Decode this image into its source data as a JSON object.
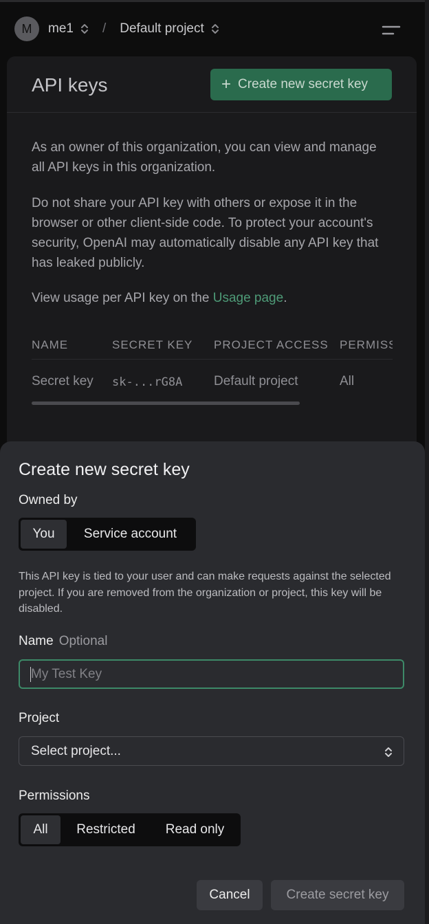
{
  "nav": {
    "avatar_initial": "M",
    "org_name": "me1",
    "separator": "/",
    "project_name": "Default project"
  },
  "page": {
    "title": "API keys",
    "create_button_label": "Create new secret key",
    "intro": "As an owner of this organization, you can view and manage all API keys in this organization.",
    "warning": "Do not share your API key with others or expose it in the browser or other client-side code. To protect your account's security, OpenAI may automatically disable any API key that has leaked publicly.",
    "usage_prefix": "View usage per API key on the ",
    "usage_link": "Usage page",
    "usage_suffix": "."
  },
  "table": {
    "columns": [
      "NAME",
      "SECRET KEY",
      "PROJECT ACCESS",
      "PERMISSIONS"
    ],
    "rows": [
      {
        "name": "Secret key",
        "secret_key": "sk-...rG8A",
        "project_access": "Default project",
        "permissions": "All"
      }
    ]
  },
  "modal": {
    "title": "Create new secret key",
    "owned_by_label": "Owned by",
    "owned_by_options": [
      "You",
      "Service account"
    ],
    "owned_by_selected": "You",
    "help_text": "This API key is tied to your user and can make requests against the selected project. If you are removed from the organization or project, this key will be disabled.",
    "name_label": "Name",
    "name_optional": "Optional",
    "name_placeholder": "My Test Key",
    "name_value": "",
    "project_label": "Project",
    "project_value": "Select project...",
    "permissions_label": "Permissions",
    "permissions_options": [
      "All",
      "Restricted",
      "Read only"
    ],
    "permissions_selected": "All",
    "cancel_label": "Cancel",
    "submit_label": "Create secret key"
  },
  "colors": {
    "accent_green": "#2a6b4d",
    "link_green": "#4e9b77",
    "modal_bg": "#2a2b2f",
    "page_bg": "#0d0d0d"
  },
  "icons": {
    "nav_chevrons": "chevron-up-down-icon",
    "menu": "menu-icon",
    "plus": "plus-icon"
  }
}
